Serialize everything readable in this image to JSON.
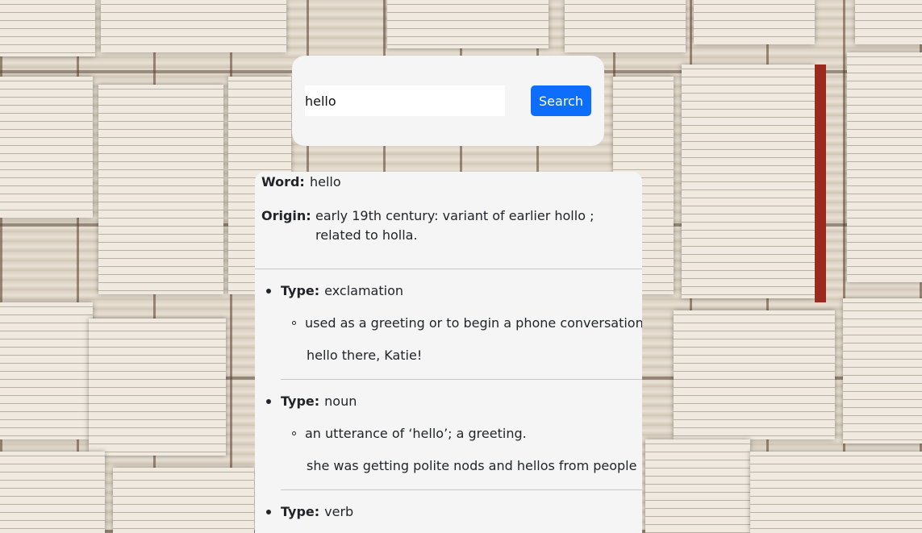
{
  "search": {
    "query_value": "hello",
    "button_label": "Search"
  },
  "result": {
    "word_label": "Word:",
    "word": "hello",
    "origin_label": "Origin:",
    "origin": "early 19th century: variant of earlier hollo ; related to holla.",
    "meanings": [
      {
        "type_label": "Type:",
        "type": "exclamation",
        "definition": "used as a greeting or to begin a phone conversation.",
        "example": "hello there, Katie!"
      },
      {
        "type_label": "Type:",
        "type": "noun",
        "definition": "an utterance of ‘hello’; a greeting.",
        "example": "she was getting polite nods and hellos from people"
      },
      {
        "type_label": "Type:",
        "type": "verb"
      }
    ]
  },
  "colors": {
    "button": "#0d6efd",
    "card": "#f5f5f5"
  }
}
